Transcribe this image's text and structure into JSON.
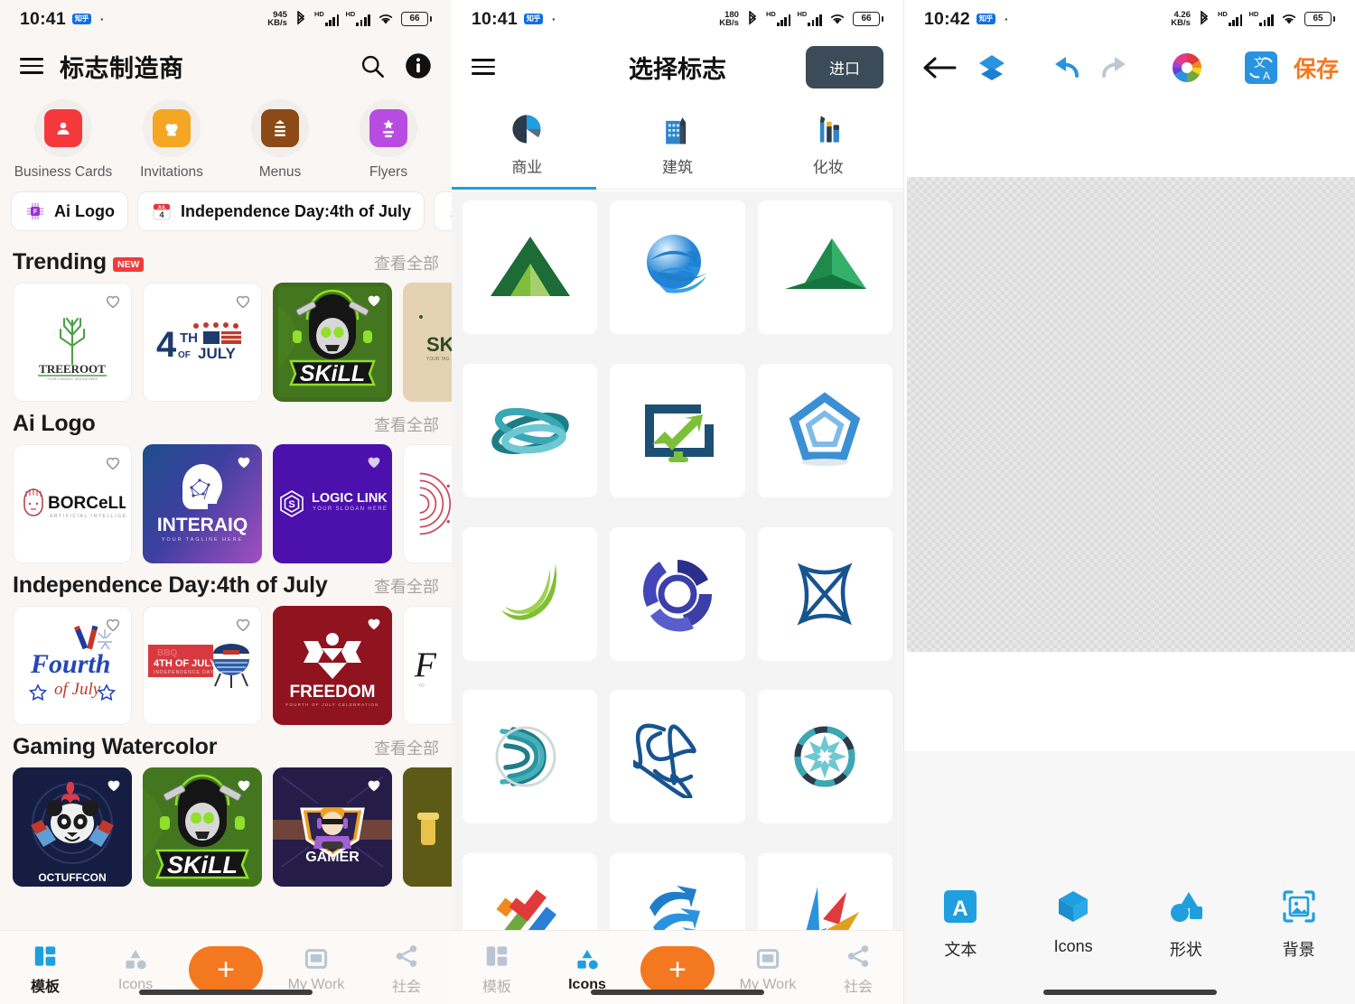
{
  "panel1": {
    "status": {
      "time": "10:41",
      "app_badge": "知乎",
      "net_speed": "945",
      "net_unit": "KB/s",
      "hd1": "HD",
      "hd2": "HD",
      "battery": "66"
    },
    "header": {
      "title": "标志制造商",
      "menu_icon": "hamburger-icon",
      "search_icon": "search-icon",
      "info_icon": "info-icon"
    },
    "categories": [
      {
        "label": "Business\nCards",
        "icon": "business-card-icon",
        "color": "#f4393c"
      },
      {
        "label": "Invitations",
        "icon": "invitation-heart-icon",
        "color": "#f5a623"
      },
      {
        "label": "Menus",
        "icon": "menu-document-icon",
        "color": "#8b4a16"
      },
      {
        "label": "Flyers",
        "icon": "flyer-star-icon",
        "color": "#b84ce0"
      }
    ],
    "chips": [
      {
        "label": "Ai Logo",
        "icon": "ai-chip-icon"
      },
      {
        "label": "Independence Day:4th of July",
        "icon": "calendar-july4-icon"
      },
      {
        "label": "",
        "icon": "palette-icon"
      }
    ],
    "sections": [
      {
        "title": "Trending",
        "badge": "NEW",
        "see_all": "查看全部",
        "cards": [
          {
            "name": "TREEROOT",
            "sub": "YOUR COMPANY TAGLINE HERE",
            "style": "treeroot",
            "faved": false
          },
          {
            "name": "4TH OF JULY",
            "style": "july4th",
            "faved": false
          },
          {
            "name": "SKILL",
            "style": "skill-green",
            "faved": true
          },
          {
            "name": "SK",
            "style": "beige-partial",
            "faved": false
          }
        ]
      },
      {
        "title": "Ai Logo",
        "badge": "",
        "see_all": "查看全部",
        "cards": [
          {
            "name": "BORCELLE",
            "sub": "ARTIFICIAL INTELLIGENCE",
            "style": "borcelle",
            "faved": false
          },
          {
            "name": "INTERAIQ",
            "sub": "YOUR TAGLINE HERE",
            "style": "interaiq",
            "faved": true
          },
          {
            "name": "LOGIC LINK",
            "sub": "YOUR SLOGAN HERE",
            "style": "logiclink",
            "faved": true
          },
          {
            "name": "",
            "style": "pink-arc-partial",
            "faved": false
          }
        ]
      },
      {
        "title": "Independence Day:4th of July",
        "badge": "",
        "see_all": "查看全部",
        "cards": [
          {
            "name": "Fourth of July",
            "style": "fourth",
            "faved": false
          },
          {
            "name": "4TH OF JULY",
            "sub": "INDEPENDENCE DAY",
            "style": "bbq",
            "faved": false
          },
          {
            "name": "FREEDOM",
            "sub": "FOURTH OF JULY CELEBRATION",
            "style": "freedom",
            "faved": true
          },
          {
            "name": "F",
            "style": "script-partial",
            "faved": false
          }
        ]
      },
      {
        "title": "Gaming Watercolor",
        "badge": "",
        "see_all": "查看全部",
        "cards": [
          {
            "name": "OCTUFFCON",
            "style": "panda",
            "faved": true
          },
          {
            "name": "SKILL",
            "style": "skill-green",
            "faved": true
          },
          {
            "name": "GAMER",
            "style": "gamer",
            "faved": true
          },
          {
            "name": "",
            "style": "olive-partial",
            "faved": false
          }
        ]
      }
    ],
    "bottom_nav": [
      {
        "label": "模板",
        "icon": "templates-icon",
        "active": true
      },
      {
        "label": "Icons",
        "icon": "shapes-icon",
        "active": false
      },
      {
        "label": "",
        "icon": "plus-fab-icon",
        "active": false
      },
      {
        "label": "My Work",
        "icon": "my-work-icon",
        "active": false
      },
      {
        "label": "社会",
        "icon": "share-icon",
        "active": false
      }
    ]
  },
  "panel2": {
    "status": {
      "time": "10:41",
      "app_badge": "知乎",
      "net_speed": "180",
      "net_unit": "KB/s",
      "hd1": "HD",
      "hd2": "HD",
      "battery": "66"
    },
    "header": {
      "title": "选择标志",
      "menu_icon": "hamburger-icon",
      "import_label": "进口"
    },
    "tabs": [
      {
        "label": "商业",
        "icon": "pie-chart-icon",
        "active": true
      },
      {
        "label": "建筑",
        "icon": "buildings-icon",
        "active": false
      },
      {
        "label": "化妆",
        "icon": "cosmetics-icon",
        "active": false
      }
    ],
    "logo_grid": [
      {
        "name": "green-mountain-triangle-logo"
      },
      {
        "name": "blue-globe-arrows-logo"
      },
      {
        "name": "green-peak-triangle-logo"
      },
      {
        "name": "teal-ribbon-orbit-logo"
      },
      {
        "name": "monitor-growth-arrow-logo"
      },
      {
        "name": "blue-pentagon-gem-logo"
      },
      {
        "name": "green-leaf-swoosh-logo"
      },
      {
        "name": "navy-circular-swirl-logo"
      },
      {
        "name": "blue-atom-cross-logo"
      },
      {
        "name": "teal-sphere-lines-logo"
      },
      {
        "name": "blue-knot-loops-logo"
      },
      {
        "name": "teal-starburst-ring-logo"
      },
      {
        "name": "colorful-hammer-cross-logo"
      },
      {
        "name": "blue-wave-arrows-logo"
      },
      {
        "name": "multicolor-swift-bird-logo"
      }
    ],
    "bottom_nav": [
      {
        "label": "模板",
        "icon": "templates-icon",
        "active": false
      },
      {
        "label": "Icons",
        "icon": "shapes-icon",
        "active": true
      },
      {
        "label": "",
        "icon": "plus-fab-icon",
        "active": false
      },
      {
        "label": "My Work",
        "icon": "my-work-icon",
        "active": false
      },
      {
        "label": "社会",
        "icon": "share-icon",
        "active": false
      }
    ]
  },
  "panel3": {
    "status": {
      "time": "10:42",
      "app_badge": "知乎",
      "net_speed": "4.26",
      "net_unit": "KB/s",
      "hd1": "HD",
      "hd2": "HD",
      "battery": "65"
    },
    "toolbar": {
      "back_icon": "back-arrow-icon",
      "layers_icon": "layers-icon",
      "undo_icon": "undo-icon",
      "redo_icon": "redo-icon",
      "color_icon": "color-wheel-icon",
      "translate_icon": "translate-icon",
      "save_label": "保存",
      "save_color": "#f4781f"
    },
    "canvas": {
      "name": "transparent-canvas",
      "state": "empty"
    },
    "tools": [
      {
        "label": "文本",
        "icon": "text-icon"
      },
      {
        "label": "Icons",
        "icon": "cube-icon"
      },
      {
        "label": "形状",
        "icon": "shapes-tool-icon"
      },
      {
        "label": "背景",
        "icon": "background-image-icon"
      }
    ]
  }
}
